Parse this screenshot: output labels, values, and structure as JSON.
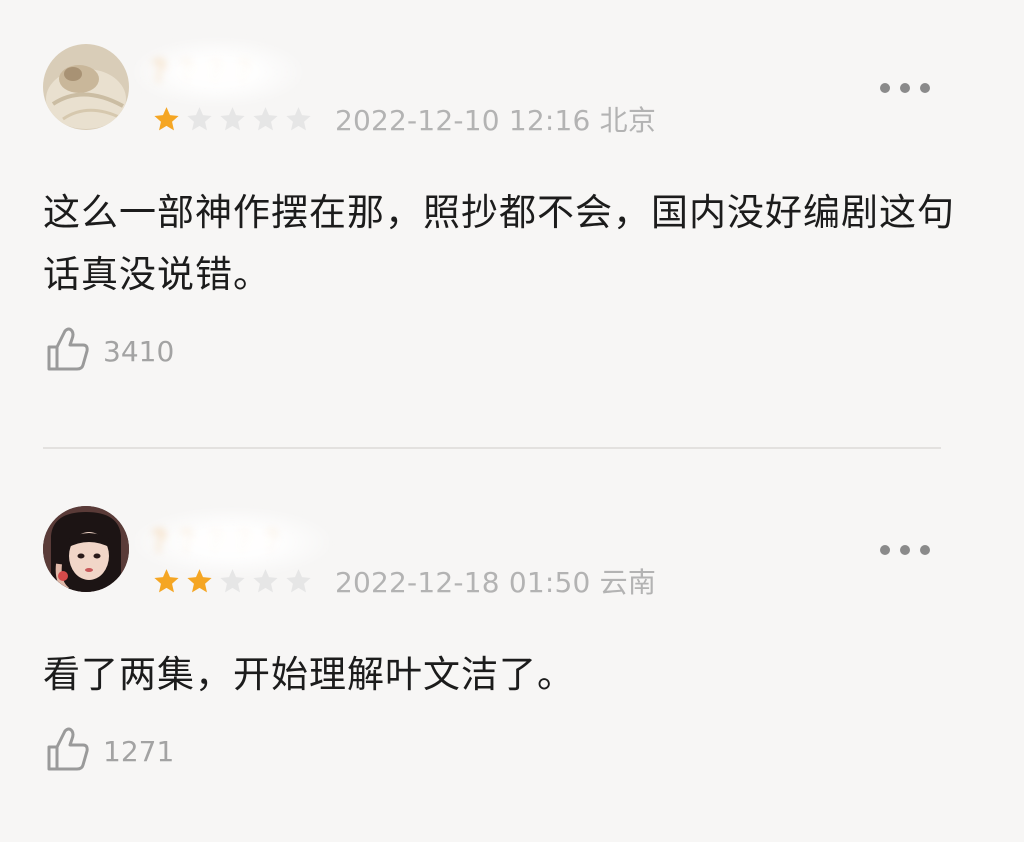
{
  "comments": [
    {
      "username": "？？？？",
      "rating": 1,
      "max_rating": 5,
      "timestamp": "2022-12-10 12:16 北京",
      "text": "这么一部神作摆在那，照抄都不会，国内没好编剧这句话真没说错。",
      "likes": "3410"
    },
    {
      "username": "？？？？？",
      "rating": 2,
      "max_rating": 5,
      "timestamp": "2022-12-18 01:50 云南",
      "text": "看了两集，开始理解叶文洁了。",
      "likes": "1271"
    }
  ],
  "colors": {
    "background": "#f7f6f5",
    "star_filled": "#f5a623",
    "star_empty": "#e6e6e6",
    "meta_text": "#b3b3b3",
    "divider": "#e3e1df"
  },
  "icons": {
    "more": "more-dots-icon",
    "like": "thumbs-up-icon",
    "star": "star-icon"
  }
}
